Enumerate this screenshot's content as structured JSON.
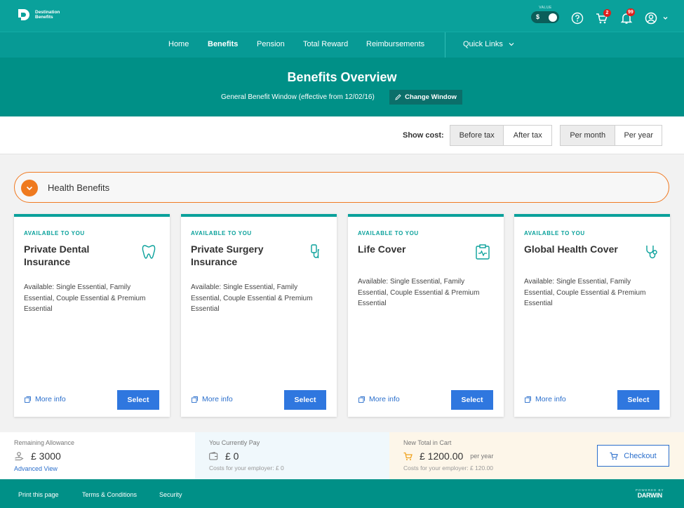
{
  "app": {
    "logo_line1": "Destination",
    "logo_line2": "Benefits",
    "value_label": "VALUE",
    "value_symbol": "$",
    "cart_count": "2",
    "notifications_count": "99"
  },
  "nav": {
    "items": [
      {
        "label": "Home",
        "active": false
      },
      {
        "label": "Benefits",
        "active": true
      },
      {
        "label": "Pension",
        "active": false
      },
      {
        "label": "Total Reward",
        "active": false
      },
      {
        "label": "Reimbursements",
        "active": false
      }
    ],
    "quick_links": "Quick Links"
  },
  "hero": {
    "title": "Benefits Overview",
    "window_text": "General Benefit Window (effective from 12/02/16)",
    "change_window": "Change Window"
  },
  "cost": {
    "label": "Show cost:",
    "tax_options": [
      "Before tax",
      "After tax"
    ],
    "tax_selected": "Before tax",
    "period_options": [
      "Per month",
      "Per year"
    ],
    "period_selected": "Per month"
  },
  "section": {
    "label": "Health Benefits"
  },
  "cards": [
    {
      "tag": "AVAILABLE TO YOU",
      "title": "Private Dental Insurance",
      "icon": "tooth-icon",
      "desc": "Available: Single Essential, Family Essential, Couple Essential & Premium Essential",
      "more": "More info",
      "select": "Select"
    },
    {
      "tag": "AVAILABLE TO YOU",
      "title": "Private Surgery Insurance",
      "icon": "iv-drip-icon",
      "desc": "Available: Single Essential, Family Essential, Couple Essential & Premium Essential",
      "more": "More info",
      "select": "Select"
    },
    {
      "tag": "AVAILABLE TO YOU",
      "title": "Life Cover",
      "icon": "clipboard-pulse-icon",
      "desc": "Available: Single Essential, Family Essential, Couple Essential & Premium Essential",
      "more": "More info",
      "select": "Select"
    },
    {
      "tag": "AVAILABLE TO YOU",
      "title": "Global Health Cover",
      "icon": "stethoscope-icon",
      "desc": "Available: Single Essential, Family Essential, Couple Essential & Premium Essential",
      "more": "More info",
      "select": "Select"
    }
  ],
  "summary": {
    "remaining_label": "Remaining Allowance",
    "remaining_value": "£ 3000",
    "advanced_view": "Advanced View",
    "current_label": "You Currently Pay",
    "current_value": "£ 0",
    "current_employer": "Costs for your employer: £ 0",
    "new_label": "New Total in Cart",
    "new_value": "£ 1200.00",
    "new_period": "per year",
    "new_employer": "Costs for your employer: £ 120.00",
    "checkout": "Checkout"
  },
  "footer": {
    "links": [
      "Print this page",
      "Terms & Conditions",
      "Security"
    ],
    "powered_by": "POWERED BY",
    "brand": "DARWIN"
  },
  "colors": {
    "teal": "#0aa19b",
    "teal_dark": "#009087",
    "orange": "#ef7a1f",
    "blue": "#2f77df",
    "badge_red": "#e0201d"
  }
}
